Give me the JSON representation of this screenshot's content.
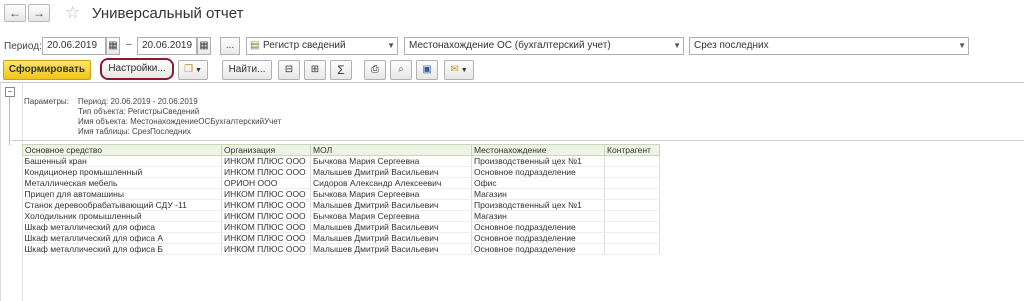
{
  "window": {
    "title": "Универсальный отчет"
  },
  "nav": {
    "back": "←",
    "forward": "→",
    "favorite": "☆"
  },
  "filters": {
    "period_label": "Период:",
    "date_from": "20.06.2019",
    "date_to": "20.06.2019",
    "dash": "–",
    "ellipsis": "...",
    "register_type": "Регистр сведений",
    "register_name": "Местонахождение ОС (бухгалтерский учет)",
    "table_name": "Срез последних"
  },
  "toolbar": {
    "generate": "Сформировать",
    "settings": "Настройки...",
    "find": "Найти...",
    "sum": "Σ"
  },
  "params": {
    "label": "Параметры:",
    "lines": [
      "Период: 20.06.2019 - 20.06.2019",
      "Тип объекта: РегистрыСведений",
      "Имя объекта: МестонахождениеОСБухгалтерскийУчет",
      "Имя таблицы: СрезПоследних"
    ]
  },
  "table": {
    "headers": [
      "Основное средство",
      "Организация",
      "МОЛ",
      "Местонахождение",
      "Контрагент"
    ],
    "rows": [
      [
        "Башенный кран",
        "ИНКОМ ПЛЮС ООО",
        "Бычкова Мария Сергеевна",
        "Производственный цех №1",
        ""
      ],
      [
        "Кондиционер промышленный",
        "ИНКОМ ПЛЮС ООО",
        "Малышев Дмитрий Васильевич",
        "Основное подразделение",
        ""
      ],
      [
        "Металлическая мебель",
        "ОРИОН ООО",
        "Сидоров Александр Алексеевич",
        "Офис",
        ""
      ],
      [
        "Прицеп для автомашины",
        "ИНКОМ ПЛЮС ООО",
        "Бычкова Мария Сергеевна",
        "Магазин",
        ""
      ],
      [
        "Станок деревообрабатывающий СДУ -11",
        "ИНКОМ ПЛЮС ООО",
        "Малышев Дмитрий Васильевич",
        "Производственный цех №1",
        ""
      ],
      [
        "Холодильник промышленный",
        "ИНКОМ ПЛЮС ООО",
        "Бычкова Мария Сергеевна",
        "Магазин",
        ""
      ],
      [
        "Шкаф металлический для офиса",
        "ИНКОМ ПЛЮС ООО",
        "Малышев Дмитрий Васильевич",
        "Основное подразделение",
        ""
      ],
      [
        "Шкаф металлический для офиса А",
        "ИНКОМ ПЛЮС ООО",
        "Малышев Дмитрий Васильевич",
        "Основное подразделение",
        ""
      ],
      [
        "Шкаф металлический для офиса Б",
        "ИНКОМ ПЛЮС ООО",
        "Малышев Дмитрий Васильевич",
        "Основное подразделение",
        ""
      ]
    ]
  }
}
